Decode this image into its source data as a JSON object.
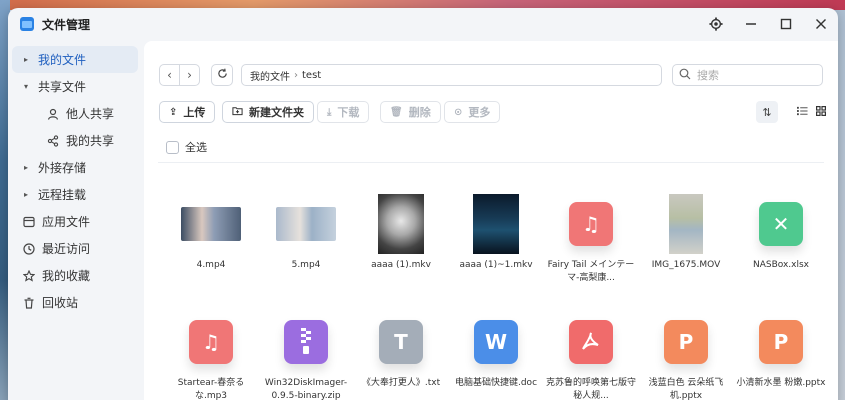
{
  "app": {
    "title": "文件管理"
  },
  "sidebar": {
    "items": [
      {
        "label": "我的文件",
        "icon": "caret-right-icon",
        "active": true
      },
      {
        "label": "共享文件",
        "icon": "caret-down-icon"
      },
      {
        "label": "他人共享",
        "icon": "person-icon"
      },
      {
        "label": "我的共享",
        "icon": "share-icon"
      },
      {
        "label": "外接存储",
        "icon": "caret-right-icon"
      },
      {
        "label": "远程挂载",
        "icon": "caret-right-icon"
      },
      {
        "label": "应用文件",
        "icon": "app-icon"
      },
      {
        "label": "最近访问",
        "icon": "clock-icon"
      },
      {
        "label": "我的收藏",
        "icon": "star-icon"
      },
      {
        "label": "回收站",
        "icon": "trash-icon"
      }
    ]
  },
  "address": {
    "root": "我的文件",
    "current": "test"
  },
  "search": {
    "placeholder": "搜索"
  },
  "toolbar": {
    "upload": "上传",
    "new_folder": "新建文件夹",
    "download": "下载",
    "delete": "删除",
    "more": "更多"
  },
  "select_all": "全选",
  "files": [
    {
      "name": "4.mp4",
      "kind": "image-anime"
    },
    {
      "name": "5.mp4",
      "kind": "image-anime"
    },
    {
      "name": "aaaa (1).mkv",
      "kind": "image-wolf"
    },
    {
      "name": "aaaa (1)~1.mkv",
      "kind": "image-dark"
    },
    {
      "name": "Fairy Tail メインテーマ-高梨康...",
      "kind": "music"
    },
    {
      "name": "IMG_1675.MOV",
      "kind": "image-photo"
    },
    {
      "name": "NASBox.xlsx",
      "kind": "xls"
    },
    {
      "name": "Startear-春奈るな.mp3",
      "kind": "music"
    },
    {
      "name": "Win32DiskImager-0.9.5-binary.zip",
      "kind": "zip"
    },
    {
      "name": "《大奉打更人》.txt",
      "kind": "txt"
    },
    {
      "name": "电脑基础快捷键.doc",
      "kind": "word"
    },
    {
      "name": "克苏鲁的呼唤第七版守秘人规...",
      "kind": "pdf"
    },
    {
      "name": "浅蓝白色 云朵纸飞机.pptx",
      "kind": "ppt"
    },
    {
      "name": "小清新水墨 粉嫩.pptx",
      "kind": "ppt"
    }
  ],
  "colors": {
    "accent": "#1f5fbf",
    "window_bg": "#f3f5f8"
  }
}
